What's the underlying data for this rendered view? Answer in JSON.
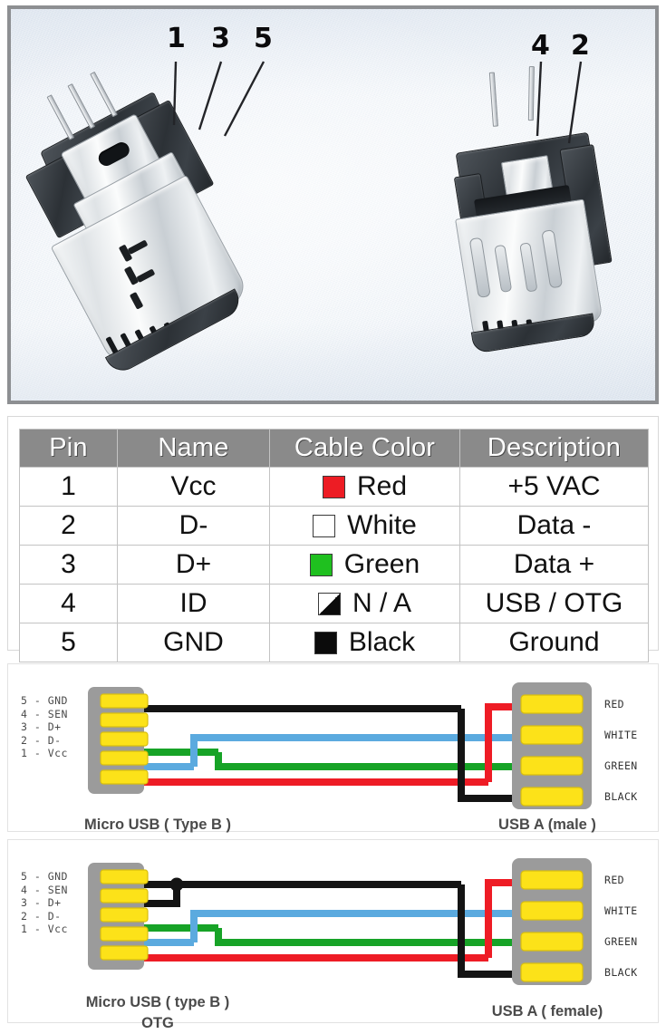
{
  "photo": {
    "alt": "Two micro USB type B male connector photographs on light background",
    "callouts_left": [
      "1",
      "3",
      "5"
    ],
    "callouts_right": [
      "4",
      "2"
    ]
  },
  "table": {
    "headers": [
      "Pin",
      "Name",
      "Cable Color",
      "Description"
    ],
    "rows": [
      {
        "pin": "1",
        "name": "Vcc",
        "color_label": "Red",
        "swatch": "#ED1C24",
        "swatch_kind": "solid",
        "description": "+5 VAC"
      },
      {
        "pin": "2",
        "name": "D-",
        "color_label": "White",
        "swatch": "#FFFFFF",
        "swatch_kind": "solid",
        "description": "Data -"
      },
      {
        "pin": "3",
        "name": "D+",
        "color_label": "Green",
        "swatch": "#1FC01F",
        "swatch_kind": "solid",
        "description": "Data +"
      },
      {
        "pin": "4",
        "name": "ID",
        "color_label": "N / A",
        "swatch": "#0B0B0B",
        "swatch_kind": "triangle",
        "description": "USB / OTG"
      },
      {
        "pin": "5",
        "name": "GND",
        "color_label": "Black",
        "swatch": "#0B0B0B",
        "swatch_kind": "solid",
        "description": "Ground"
      }
    ]
  },
  "diagram1": {
    "left_pin_labels": "5 - GND\n4 - SEN\n3 - D+\n2 - D-\n1 - Vcc",
    "left_caption": "Micro USB ( Type B )",
    "right_caption": "USB A (male )",
    "right_wire_labels": [
      "RED",
      "WHITE",
      "GREEN",
      "BLACK"
    ],
    "jumper": false
  },
  "diagram2": {
    "left_pin_labels": "5 - GND\n4 - SEN\n3 - D+\n2 - D-\n1 - Vcc",
    "left_caption": "Micro USB ( type B )\nOTG",
    "right_caption": "USB A ( female)",
    "right_wire_labels": [
      "RED",
      "WHITE",
      "GREEN",
      "BLACK"
    ],
    "jumper": true
  },
  "colors": {
    "wire_red": "#EE1C25",
    "wire_white_blue": "#5BAADF",
    "wire_green": "#17A327",
    "wire_black": "#141414",
    "connector_body": "#9B9B9B",
    "pad_yellow": "#FCE219",
    "header_gray": "#8A8A8A",
    "photo_border": "#8D8F92"
  }
}
